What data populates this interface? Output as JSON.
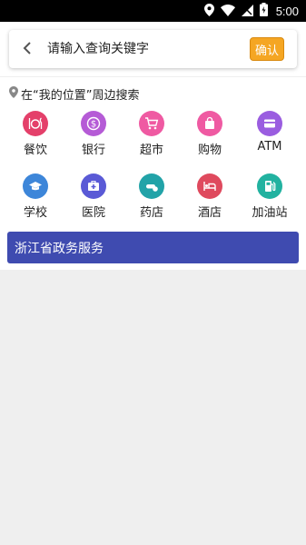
{
  "status_bar": {
    "time": "5:00"
  },
  "search": {
    "placeholder": "请输入查询关键字",
    "confirm_label": "确认"
  },
  "nearby": {
    "title": "在“我的位置”周边搜索"
  },
  "categories": [
    {
      "label": "餐饮",
      "icon": "dining-icon",
      "color": "#e4406a"
    },
    {
      "label": "银行",
      "icon": "bank-icon",
      "color": "#b55bd6"
    },
    {
      "label": "超市",
      "icon": "supermarket-cart-icon",
      "color": "#ef5aa2"
    },
    {
      "label": "购物",
      "icon": "shopping-bag-icon",
      "color": "#ef5aa2"
    },
    {
      "label": "ATM",
      "icon": "atm-card-icon",
      "color": "#9a5de0"
    },
    {
      "label": "学校",
      "icon": "school-cap-icon",
      "color": "#3d86d9"
    },
    {
      "label": "医院",
      "icon": "hospital-icon",
      "color": "#5a5ad6"
    },
    {
      "label": "药店",
      "icon": "pharmacy-pill-icon",
      "color": "#22a3a8"
    },
    {
      "label": "酒店",
      "icon": "hotel-bed-icon",
      "color": "#df4a5e"
    },
    {
      "label": "加油站",
      "icon": "gas-station-icon",
      "color": "#22b2a0"
    }
  ],
  "banner": {
    "label": "浙江省政务服务"
  }
}
